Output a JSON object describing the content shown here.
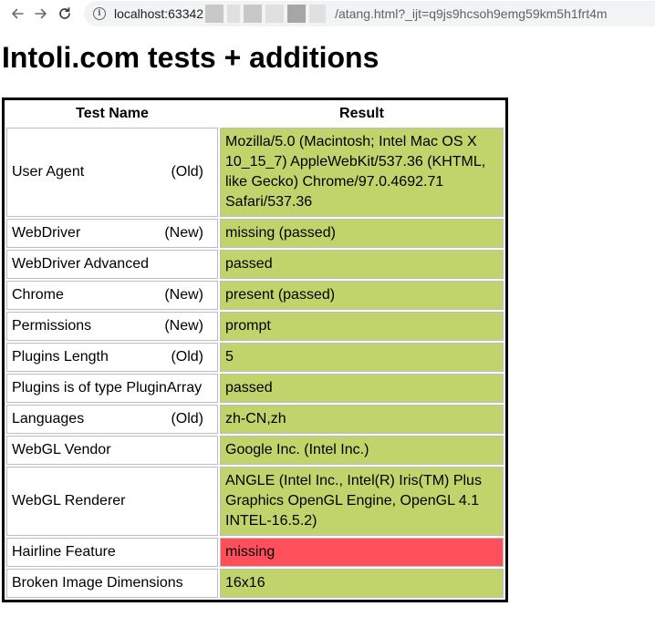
{
  "browser": {
    "url_host": "localhost:63342",
    "url_path": "/atang.html?_ijt=q9js9hcsoh9emg59km5h1frt4m"
  },
  "page": {
    "title": "Intoli.com tests + additions"
  },
  "table": {
    "headers": {
      "name": "Test Name",
      "result": "Result"
    },
    "rows": [
      {
        "name": "User Agent",
        "tag": "(Old)",
        "result": "Mozilla/5.0 (Macintosh; Intel Mac OS X 10_15_7) AppleWebKit/537.36 (KHTML, like Gecko) Chrome/97.0.4692.71 Safari/537.36",
        "status": "pass"
      },
      {
        "name": "WebDriver",
        "tag": "(New)",
        "result": "missing (passed)",
        "status": "pass"
      },
      {
        "name": "WebDriver Advanced",
        "tag": "",
        "result": "passed",
        "status": "pass"
      },
      {
        "name": "Chrome",
        "tag": "(New)",
        "result": "present (passed)",
        "status": "pass"
      },
      {
        "name": "Permissions",
        "tag": "(New)",
        "result": "prompt",
        "status": "pass"
      },
      {
        "name": "Plugins Length",
        "tag": "(Old)",
        "result": "5",
        "status": "pass"
      },
      {
        "name": "Plugins is of type PluginArray",
        "tag": "",
        "result": "passed",
        "status": "pass"
      },
      {
        "name": "Languages",
        "tag": "(Old)",
        "result": "zh-CN,zh",
        "status": "pass"
      },
      {
        "name": "WebGL Vendor",
        "tag": "",
        "result": "Google Inc. (Intel Inc.)",
        "status": "pass"
      },
      {
        "name": "WebGL Renderer",
        "tag": "",
        "result": "ANGLE (Intel Inc., Intel(R) Iris(TM) Plus Graphics OpenGL Engine, OpenGL 4.1 INTEL-16.5.2)",
        "status": "pass"
      },
      {
        "name": "Hairline Feature",
        "tag": "",
        "result": "missing",
        "status": "fail"
      },
      {
        "name": "Broken Image Dimensions",
        "tag": "",
        "result": "16x16",
        "status": "pass"
      }
    ]
  },
  "colors": {
    "pass": "#c1d46b",
    "fail": "#ff4f5a"
  }
}
